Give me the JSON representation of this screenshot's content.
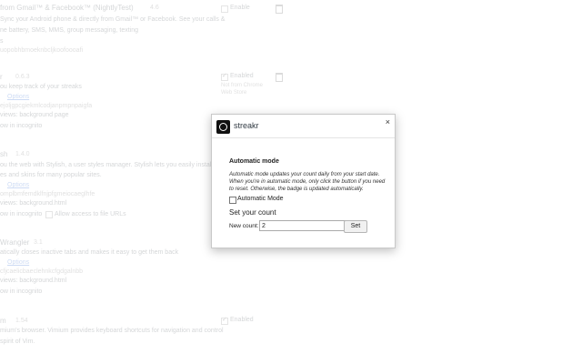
{
  "background": {
    "extensions": [
      {
        "name": "from Gmail™ & Facebook™ (NightlyTest)",
        "version": "4.6",
        "lines": [
          "Sync your Android phone & directly from Gmail™ or Facebook. See your calls &",
          "ne battery, SMS, MMS, group messaging, texting",
          "s",
          "uopobhbmoeknbcljkoofoooafi"
        ],
        "enabled_label": "Enable",
        "enabled": false
      },
      {
        "name": "r",
        "version": "0.6.3",
        "lines": [
          "ou keep track of your streaks",
          "Options",
          "ejoljgpcgiekmlcodjanpmpnpaigfa",
          "views:  background page",
          "ow in incognito"
        ],
        "enabled_label": "Enabled",
        "enabled": true,
        "store_note": [
          "Not from Chrome",
          "Web Store"
        ]
      },
      {
        "name": "sh",
        "version": "1.4.0",
        "lines": [
          "ou the web with Stylish, a user styles manager. Stylish lets you easily install",
          "es and skins for many popular sites.",
          "Options",
          "omplbmfemdklfnjpfgmeiocaeglhfe",
          "views:  background.html",
          "ow in incognito",
          "Allow access to file URLs"
        ]
      },
      {
        "name": "Wrangler",
        "version": "3.1",
        "lines": [
          "atically closes inactive tabs and makes it easy to get them back",
          "Options",
          "cfjcaelicbaeclehnkcfgdgalnbb",
          "views:  background.html",
          "ow in incognito"
        ]
      },
      {
        "name": "m",
        "version": "1.54",
        "lines": [
          "mium's browser. Vimium provides keyboard shortcuts for navigation and control",
          "spirit of Vim."
        ],
        "enabled_label": "Enabled",
        "enabled": true
      }
    ]
  },
  "dialog": {
    "title": "streakr",
    "close_symbol": "×",
    "section_title": "Automatic mode",
    "description": "Automatic mode updates your count daily from your start date. When you're in automatic mode, only click the button if you need to reset. Otherwise, the badge is updated automatically.",
    "automatic_mode_label": "Automatic Mode",
    "automatic_mode_checked": false,
    "set_count_title": "Set your count",
    "new_count_label": "New count:",
    "new_count_value": "2",
    "set_button_label": "Set"
  }
}
